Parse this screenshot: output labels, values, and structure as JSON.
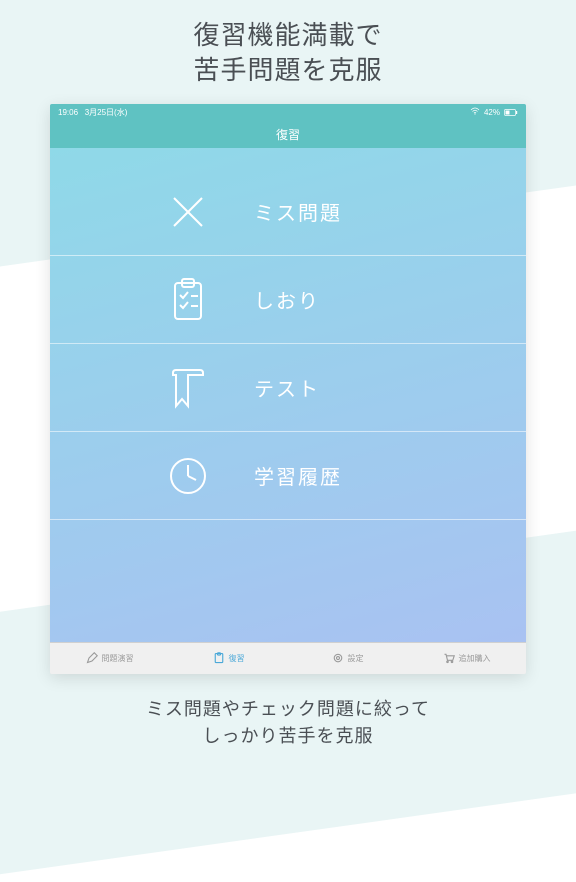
{
  "headline": {
    "line1": "復習機能満載で",
    "line2": "苦手問題を克服"
  },
  "statusbar": {
    "time": "19:06",
    "date": "3月25日(水)",
    "battery": "42%"
  },
  "navbar": {
    "title": "復習"
  },
  "menu": [
    {
      "label": "ミス問題",
      "icon": "x-icon"
    },
    {
      "label": "しおり",
      "icon": "clipboard-check-icon"
    },
    {
      "label": "テスト",
      "icon": "flag-icon"
    },
    {
      "label": "学習履歴",
      "icon": "clock-icon"
    }
  ],
  "tabs": [
    {
      "label": "問題演習",
      "icon": "pencil-icon",
      "active": false
    },
    {
      "label": "復習",
      "icon": "clipboard-icon",
      "active": true
    },
    {
      "label": "設定",
      "icon": "gear-icon",
      "active": false
    },
    {
      "label": "追加購入",
      "icon": "cart-icon",
      "active": false
    }
  ],
  "caption": {
    "line1": "ミス問題やチェック問題に絞って",
    "line2": "しっかり苦手を克服"
  }
}
